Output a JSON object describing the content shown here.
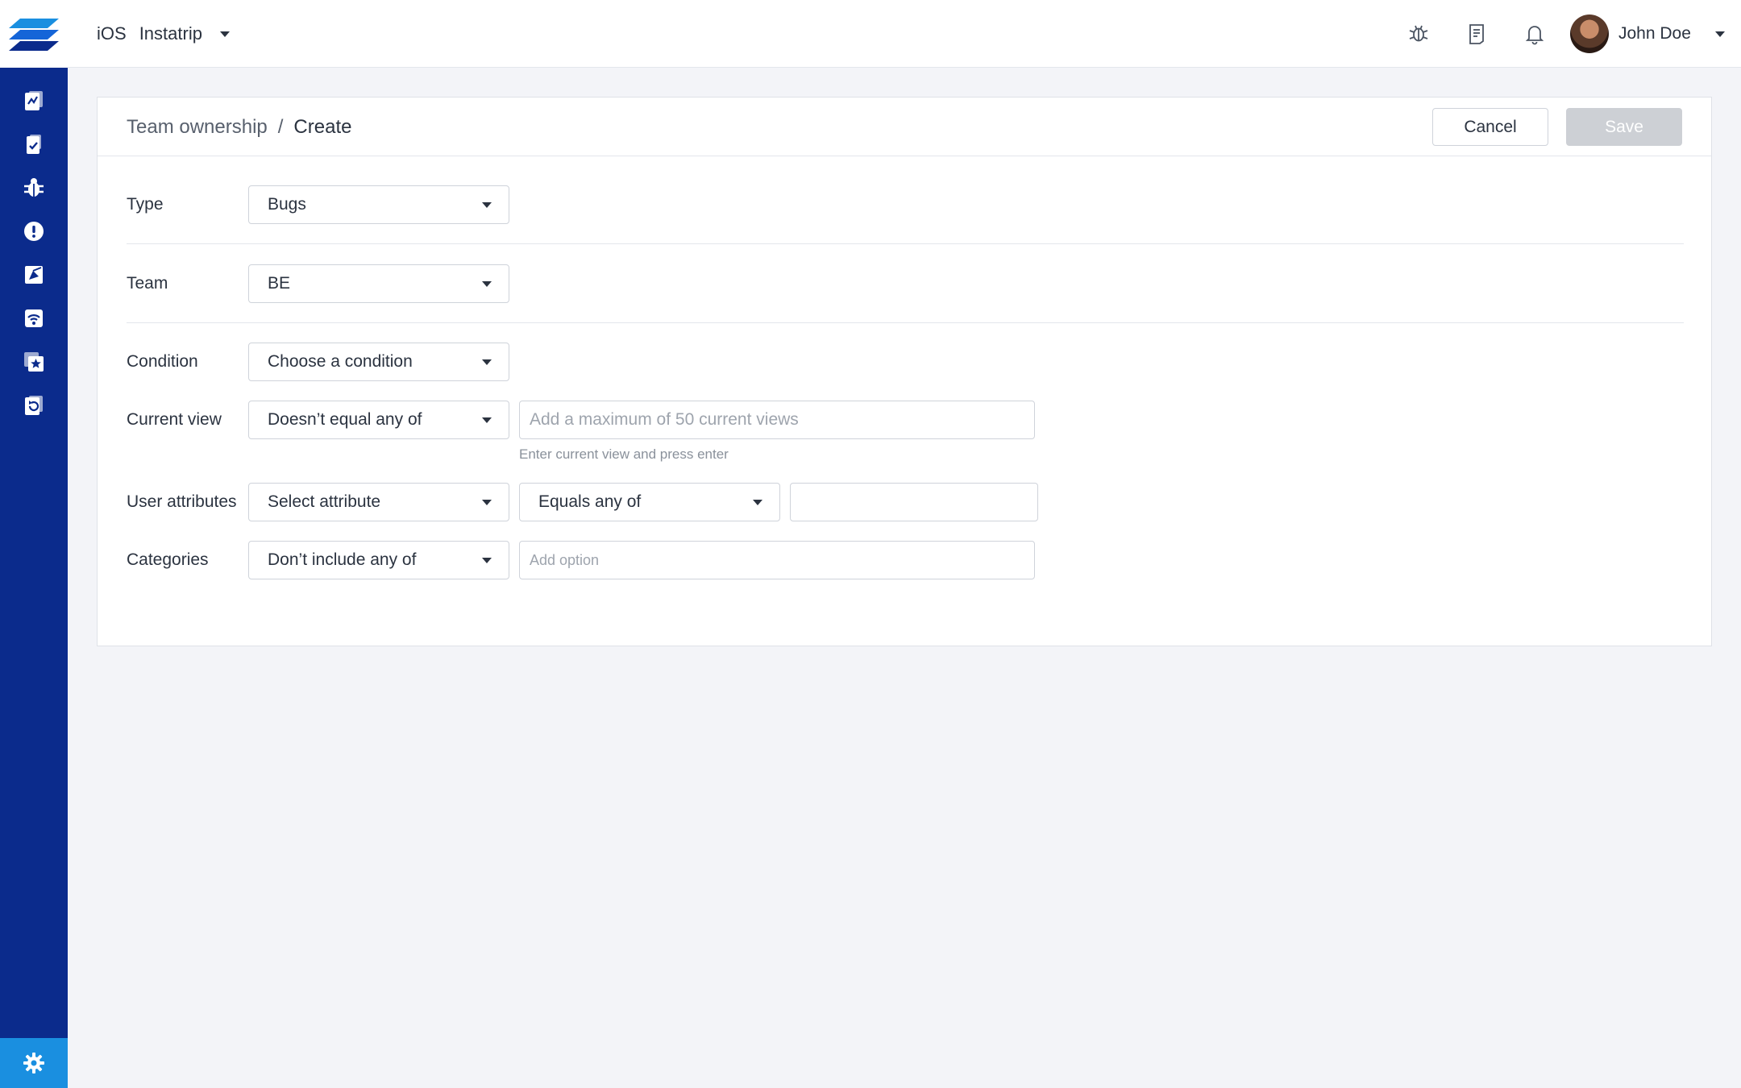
{
  "topbar": {
    "platform": "iOS",
    "app_name": "Instatrip",
    "user_name": "John Doe"
  },
  "breadcrumb": {
    "parent": "Team ownership",
    "separator": "/",
    "current": "Create"
  },
  "actions": {
    "cancel_label": "Cancel",
    "save_label": "Save"
  },
  "form": {
    "type": {
      "label": "Type",
      "value": "Bugs"
    },
    "team": {
      "label": "Team",
      "value": "BE"
    },
    "condition": {
      "label": "Condition",
      "value": "Choose a condition"
    },
    "current_view": {
      "label": "Current view",
      "operator": "Doesn’t equal any of",
      "placeholder": "Add a maximum of 50 current views",
      "helper": "Enter current view and press enter"
    },
    "user_attributes": {
      "label": "User attributes",
      "attribute": "Select attribute",
      "operator": "Equals any of",
      "value": ""
    },
    "categories": {
      "label": "Categories",
      "operator": "Don’t include any of",
      "placeholder": "Add option"
    }
  },
  "colors": {
    "sidebar": "#0b2b8c",
    "settings": "#1a8fe0",
    "save_disabled": "#cdd0d5",
    "background": "#f3f4f8"
  },
  "icons": {
    "sidebar": [
      "dashboard-icon",
      "crash-report-icon",
      "bug-icon",
      "alert-icon",
      "survey-icon",
      "network-icon",
      "feature-request-icon",
      "replay-icon"
    ],
    "settings": "gear-icon",
    "topbar": [
      "debug-icon",
      "release-notes-icon",
      "bell-icon"
    ]
  }
}
